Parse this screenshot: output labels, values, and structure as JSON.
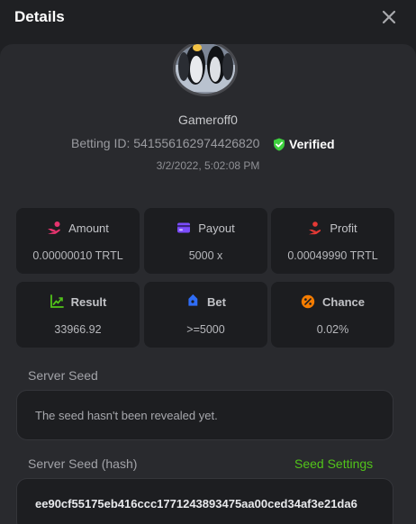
{
  "header": {
    "title": "Details",
    "close_icon": "close-icon"
  },
  "profile": {
    "avatar_icon": "penguin-avatar",
    "username": "Gameroff0",
    "betting_id_text": "Betting ID: 541556162974426820",
    "verified_label": "Verified",
    "timestamp": "3/2/2022, 5:02:08 PM"
  },
  "stats": [
    {
      "label": "Amount",
      "value": "0.00000010 TRTL",
      "icon": "hand-coin-icon",
      "color": "#e6336e"
    },
    {
      "label": "Payout",
      "value": "5000 x",
      "icon": "wallet-card-icon",
      "color": "#7c4dff"
    },
    {
      "label": "Profit",
      "value": "0.00049990 TRTL",
      "icon": "hand-up-icon",
      "color": "#e53935"
    },
    {
      "label": "Result",
      "value": "33966.92",
      "icon": "chart-trend-icon",
      "color": "#52c41a"
    },
    {
      "label": "Bet",
      "value": ">=5000",
      "icon": "tag-icon",
      "color": "#2f6df6"
    },
    {
      "label": "Chance",
      "value": "0.02%",
      "icon": "percent-icon",
      "color": "#f57c00"
    }
  ],
  "server_seed": {
    "label": "Server Seed",
    "text": "The seed hasn't been revealed yet."
  },
  "server_seed_hash": {
    "label": "Server Seed (hash)",
    "settings_label": "Seed Settings",
    "value": "ee90cf55175eb416ccc1771243893475aa00ced34af3e21da6"
  },
  "colors": {
    "accent_green": "#52c41a",
    "verified_green": "#3ecf3e"
  }
}
